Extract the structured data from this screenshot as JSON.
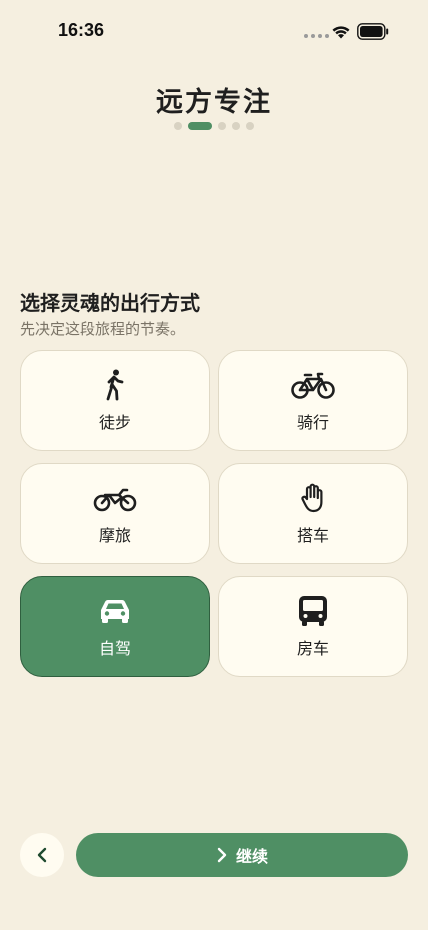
{
  "status_bar": {
    "time": "16:36",
    "signal_icon": "signal-dots-icon",
    "wifi_icon": "wifi-icon",
    "battery_icon": "battery-icon"
  },
  "header": {
    "title": "远方专注",
    "pages": {
      "total": 5,
      "current": 2
    }
  },
  "section": {
    "title": "选择灵魂的出行方式",
    "subtitle": "先决定这段旅程的节奏。"
  },
  "options": [
    {
      "label": "徒步",
      "icon": "walking-icon",
      "selected": false
    },
    {
      "label": "骑行",
      "icon": "bicycle-icon",
      "selected": false
    },
    {
      "label": "摩旅",
      "icon": "motorcycle-icon",
      "selected": false
    },
    {
      "label": "搭车",
      "icon": "hand-icon",
      "selected": false
    },
    {
      "label": "自驾",
      "icon": "car-icon",
      "selected": true
    },
    {
      "label": "房车",
      "icon": "bus-icon",
      "selected": false
    }
  ],
  "footer": {
    "back_icon": "chevron-left-icon",
    "continue_icon": "chevron-right-icon",
    "continue_label": "继续"
  },
  "colors": {
    "background": "#f5efe0",
    "accent": "#4f8f64",
    "card": "#fffcf1"
  }
}
